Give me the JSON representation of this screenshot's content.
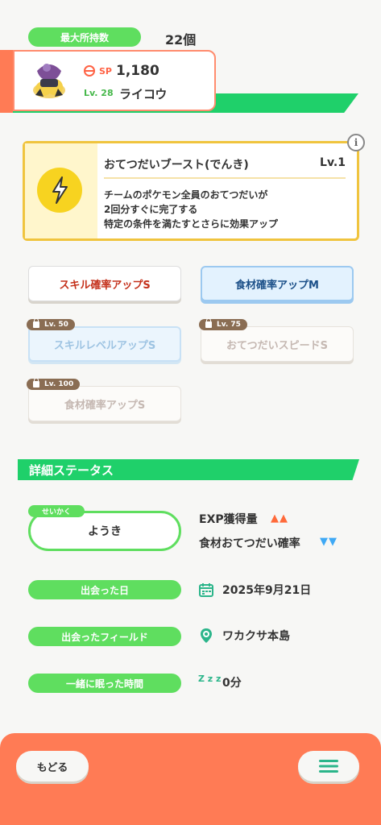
{
  "header": {
    "max_label": "最大所持数",
    "max_value": "22個"
  },
  "pokemon": {
    "sp_label": "SP",
    "sp_value": "1,180",
    "level": "Lv. 28",
    "name": "ライコウ"
  },
  "main_skill": {
    "name": "おてつだいブースト(でんき)",
    "level": "Lv.1",
    "description": [
      "チームのポケモン全員のおてつだいが",
      "2回分すぐに完了する",
      "特定の条件を満たすとさらに効果アップ"
    ],
    "icon": "lightning-icon",
    "info_icon": "i"
  },
  "sub_skills": [
    {
      "label": "スキル確率アップS",
      "lock_level": "",
      "style": "gold"
    },
    {
      "label": "食材確率アップM",
      "lock_level": "",
      "style": "blue"
    },
    {
      "label": "スキルレベルアップS",
      "lock_level": "Lv. 50",
      "style": "locked-blue"
    },
    {
      "label": "おてつだいスピードS",
      "lock_level": "Lv. 75",
      "style": "locked-white"
    },
    {
      "label": "食材確率アップS",
      "lock_level": "Lv. 100",
      "style": "locked-white"
    }
  ],
  "details": {
    "title": "詳細ステータス",
    "nature_tag": "せいかく",
    "nature": "ようき",
    "nature_up": "EXP獲得量",
    "nature_up_arrows": "▲▲",
    "nature_down": "食材おてつだい確率",
    "nature_down_arrows": "▼▼",
    "met_date_label": "出会った日",
    "met_date": "2025年9月21日",
    "met_field_label": "出会ったフィールド",
    "met_field": "ワカクサ本島",
    "slept_label": "一緒に眠った時間",
    "slept_value": "0分",
    "sleep_icon_text": "Z z z"
  },
  "footer": {
    "back_label": "もどる",
    "menu_icon": "hamburger-menu-icon"
  },
  "colors": {
    "green": "#1fd06a",
    "pill_green": "#5fde5f",
    "orange": "#ff7b55",
    "gold": "#f0c43e"
  }
}
